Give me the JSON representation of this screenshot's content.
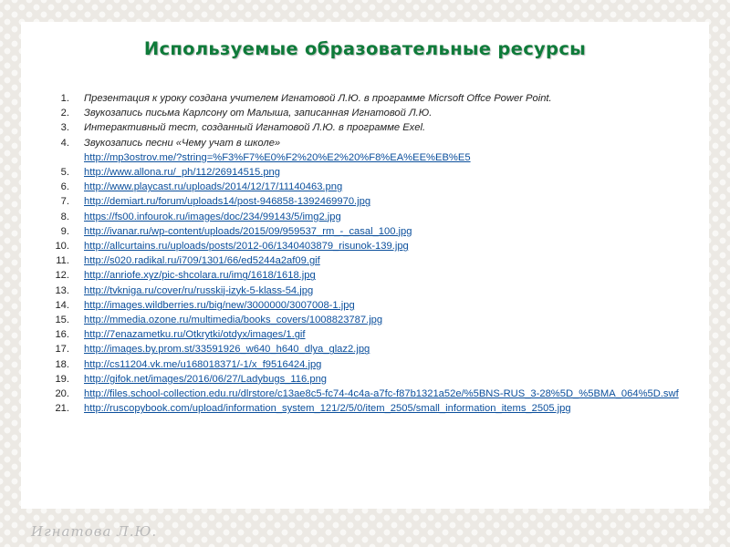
{
  "slide": {
    "title": "Используемые образовательные ресурсы",
    "signature": "Игнатова Л.Ю."
  },
  "resources": [
    {
      "num": "1.",
      "text": "Презентация к уроку создана учителем Игнатовой Л.Ю. в программе Micrsoft Offce Power Point."
    },
    {
      "num": "2.",
      "text": "Звукозапись письма Карлсону от Малыша, записанная Игнатовой Л.Ю."
    },
    {
      "num": "3.",
      "text": "Интерактивный тест,  созданный Игнатовой Л.Ю. в программе Exel."
    },
    {
      "num": "4.",
      "text": "Звукозапись песни «Чему учат в школе»",
      "link": "http://mp3ostrov.me/?string=%F3%F7%E0%F2%20%E2%20%F8%EA%EE%EB%E5"
    },
    {
      "num": "5.",
      "link": "http://www.allona.ru/_ph/112/26914515.png"
    },
    {
      "num": "6.",
      "link": "http://www.playcast.ru/uploads/2014/12/17/11140463.png"
    },
    {
      "num": "7.",
      "link": "http://demiart.ru/forum/uploads14/post-946858-1392469970.jpg"
    },
    {
      "num": "8.",
      "link": "https://fs00.infourok.ru/images/doc/234/99143/5/img2.jpg"
    },
    {
      "num": "9.",
      "link": "http://ivanar.ru/wp-content/uploads/2015/09/959537_rm_-_casal_100.jpg"
    },
    {
      "num": "10.",
      "link": "http://allcurtains.ru/uploads/posts/2012-06/1340403879_risunok-139.jpg"
    },
    {
      "num": "11.",
      "link": "http://s020.radikal.ru/i709/1301/66/ed5244a2af09.gif"
    },
    {
      "num": "12.",
      "link": "http://anriofe.xyz/pic-shcolara.ru/img/1618/1618.jpg"
    },
    {
      "num": "13.",
      "link": "http://tvkniga.ru/cover/ru/russkij-izyk-5-klass-54.jpg"
    },
    {
      "num": "14.",
      "link": "http://images.wildberries.ru/big/new/3000000/3007008-1.jpg"
    },
    {
      "num": "15.",
      "link": "http://mmedia.ozone.ru/multimedia/books_covers/1008823787.jpg"
    },
    {
      "num": "16.",
      "link": "http://7enazametku.ru/Otkrytki/otdyx/images/1.gif"
    },
    {
      "num": "17.",
      "link": "http://images.by.prom.st/33591926_w640_h640_dlya_glaz2.jpg"
    },
    {
      "num": "18.",
      "link": "http://cs11204.vk.me/u168018371/-1/x_f9516424.jpg"
    },
    {
      "num": "19.",
      "link": "http://gifok.net/images/2016/06/27/Ladybugs_116.png"
    },
    {
      "num": "20.",
      "link": "http://files.school-collection.edu.ru/dlrstore/c13ae8c5-fc74-4c4a-a7fc-f87b1321a52e/%5BNS-RUS_3-28%5D_%5BMA_064%5D.swf"
    },
    {
      "num": "21.",
      "link": "http://ruscopybook.com/upload/information_system_121/2/5/0/item_2505/small_information_items_2505.jpg"
    }
  ]
}
